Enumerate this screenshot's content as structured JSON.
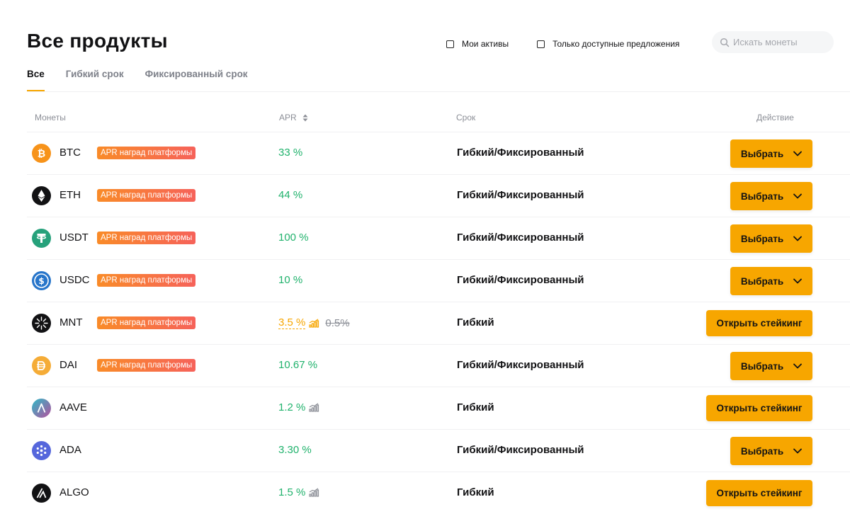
{
  "page": {
    "title": "Все продукты",
    "filters": [
      {
        "label": "Мои активы",
        "checked": false
      },
      {
        "label": "Только доступные предложения",
        "checked": false
      }
    ],
    "search": {
      "placeholder": "Искать монеты",
      "value": ""
    },
    "tabs": [
      {
        "label": "Все",
        "active": true
      },
      {
        "label": "Гибкий срок",
        "active": false
      },
      {
        "label": "Фиксированный срок",
        "active": false
      }
    ]
  },
  "table": {
    "headers": {
      "coins": "Монеты",
      "apr": "APR",
      "term": "Срок",
      "action": "Действие"
    },
    "rows": [
      {
        "coin": "BTC",
        "icon": "btc-icon",
        "badge": "APR наград платформы",
        "apr": "33 %",
        "apr_old": "",
        "apr_boost": false,
        "trend": false,
        "term": "Гибкий/Фиксированный",
        "action": "Выбрать",
        "action_type": "select"
      },
      {
        "coin": "ETH",
        "icon": "eth-icon",
        "badge": "APR наград платформы",
        "apr": "44 %",
        "apr_old": "",
        "apr_boost": false,
        "trend": false,
        "term": "Гибкий/Фиксированный",
        "action": "Выбрать",
        "action_type": "select"
      },
      {
        "coin": "USDT",
        "icon": "usdt-icon",
        "badge": "APR наград платформы",
        "apr": "100 %",
        "apr_old": "",
        "apr_boost": false,
        "trend": false,
        "term": "Гибкий/Фиксированный",
        "action": "Выбрать",
        "action_type": "select"
      },
      {
        "coin": "USDC",
        "icon": "usdc-icon",
        "badge": "APR наград платформы",
        "apr": "10 %",
        "apr_old": "",
        "apr_boost": false,
        "trend": false,
        "term": "Гибкий/Фиксированный",
        "action": "Выбрать",
        "action_type": "select"
      },
      {
        "coin": "MNT",
        "icon": "mnt-icon",
        "badge": "APR наград платформы",
        "apr": "3.5 %",
        "apr_old": "0.5%",
        "apr_boost": true,
        "trend": true,
        "term": "Гибкий",
        "action": "Открыть стейкинг",
        "action_type": "stake"
      },
      {
        "coin": "DAI",
        "icon": "dai-icon",
        "badge": "APR наград платформы",
        "apr": "10.67 %",
        "apr_old": "",
        "apr_boost": false,
        "trend": false,
        "term": "Гибкий/Фиксированный",
        "action": "Выбрать",
        "action_type": "select"
      },
      {
        "coin": "AAVE",
        "icon": "aave-icon",
        "badge": "",
        "apr": "1.2 %",
        "apr_old": "",
        "apr_boost": false,
        "trend": true,
        "term": "Гибкий",
        "action": "Открыть стейкинг",
        "action_type": "stake"
      },
      {
        "coin": "ADA",
        "icon": "ada-icon",
        "badge": "",
        "apr": "3.30 %",
        "apr_old": "",
        "apr_boost": false,
        "trend": false,
        "term": "Гибкий/Фиксированный",
        "action": "Выбрать",
        "action_type": "select"
      },
      {
        "coin": "ALGO",
        "icon": "algo-icon",
        "badge": "",
        "apr": "1.5 %",
        "apr_old": "",
        "apr_boost": false,
        "trend": true,
        "term": "Гибкий",
        "action": "Открыть стейкинг",
        "action_type": "stake"
      }
    ]
  },
  "colors": {
    "accent": "#f7a600",
    "apr_green": "#20b26c",
    "badge_start": "#f98b28",
    "badge_end": "#f6625a"
  }
}
